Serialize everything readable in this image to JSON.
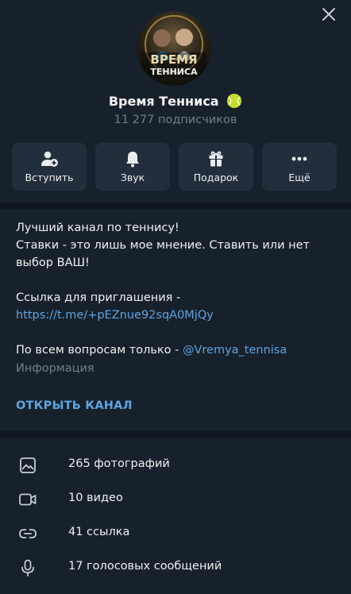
{
  "channel": {
    "name": "Время Тенниса",
    "name_emoji": "tennis-ball",
    "subscribers": "11 277 подписчиков",
    "avatar_text_top": "ВРЕМЯ",
    "avatar_text_bottom": "ТЕННИСА"
  },
  "actions": [
    {
      "label": "Вступить",
      "icon": "add-user-icon"
    },
    {
      "label": "Звук",
      "icon": "bell-icon"
    },
    {
      "label": "Подарок",
      "icon": "gift-icon"
    },
    {
      "label": "Ещё",
      "icon": "more-icon"
    }
  ],
  "description": {
    "line1": "Лучший канал по теннису!",
    "line2": "Ставки - это лишь мое мнение. Ставить или нет",
    "line3": "выбор ВАШ!",
    "line4": "",
    "line5": "Ссылка для приглашения -",
    "invite_link": "https://t.me/+pEZnue92sqA0MjQy",
    "line7": "",
    "contact_prefix": "По всем вопросам только - ",
    "contact_handle": "@Vremya_tennisa"
  },
  "info_label": "Информация",
  "open_channel": "ОТКРЫТЬ КАНАЛ",
  "media": [
    {
      "label": "265 фотографий",
      "icon": "photo-icon"
    },
    {
      "label": "10 видео",
      "icon": "video-icon"
    },
    {
      "label": "41 ссылка",
      "icon": "link-icon"
    },
    {
      "label": "17 голосовых сообщений",
      "icon": "microphone-icon"
    }
  ],
  "colors": {
    "background": "#0e1621",
    "panel": "#17212b",
    "button": "#232e3c",
    "accent": "#5ea4e0",
    "muted": "#6d7f8f"
  }
}
